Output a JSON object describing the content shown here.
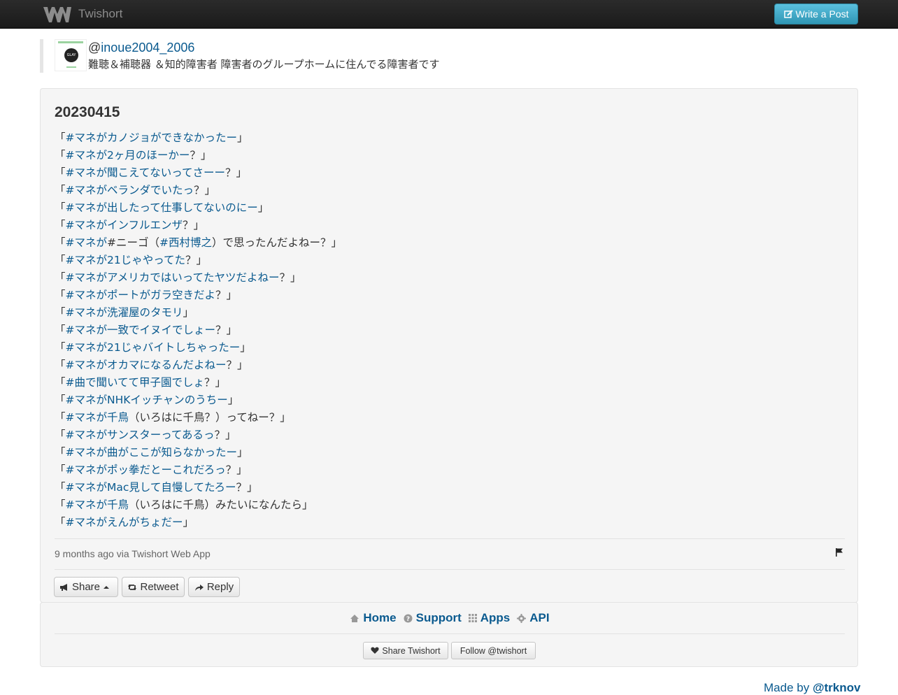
{
  "navbar": {
    "brand": "Twishort",
    "write_label": "Write a Post"
  },
  "profile": {
    "at": "@",
    "handle": "inoue2004_2006",
    "bio": "難聴＆補聴器 ＆知的障害者 障害者のグループホームに住んでる障害者です",
    "avatar_text": "GLAY"
  },
  "post": {
    "title": "20230415",
    "lines": [
      [
        "「",
        {
          "l": "#マネがカノジョができなかったー"
        },
        "」"
      ],
      [
        "「",
        {
          "l": "#マネが2ヶ月のほーかー"
        },
        "？」"
      ],
      [
        "「",
        {
          "l": "#マネが聞こえてないってさーー"
        },
        "？」"
      ],
      [
        "「",
        {
          "l": "#マネがベランダでいたっ"
        },
        "？」"
      ],
      [
        "「",
        {
          "l": "#マネが出したって仕事してないのにー"
        },
        "」"
      ],
      [
        "「",
        {
          "l": "#マネがインフルエンザ"
        },
        "？」"
      ],
      [
        "「",
        {
          "l": "#マネが"
        },
        "#ニーゴ（",
        {
          "l": "#西村博之"
        },
        "）で思ったんだよねー？」"
      ],
      [
        "「",
        {
          "l": "#マネが21じゃやってた"
        },
        "？」"
      ],
      [
        "「",
        {
          "l": "#マネがアメリカではいってたヤツだよねー"
        },
        "？」"
      ],
      [
        "「",
        {
          "l": "#マネがポートがガラ空きだよ"
        },
        "？」"
      ],
      [
        "「",
        {
          "l": "#マネが洗濯屋のタモリ"
        },
        "」"
      ],
      [
        "「",
        {
          "l": "#マネが一致でイヌイでしょー"
        },
        "？」"
      ],
      [
        "「",
        {
          "l": "#マネが21じゃバイトしちゃったー"
        },
        "」"
      ],
      [
        "「",
        {
          "l": "#マネがオカマになるんだよねー"
        },
        "？」"
      ],
      [
        "「",
        {
          "l": "#曲で聞いてて甲子園でしょ"
        },
        "？」"
      ],
      [
        "「",
        {
          "l": "#マネがNHKイッチャンのうちー"
        },
        "」"
      ],
      [
        "「",
        {
          "l": "#マネが千鳥"
        },
        "（いろはに千鳥？）ってねー？」"
      ],
      [
        "「",
        {
          "l": "#マネがサンスターってあるっ"
        },
        "？」"
      ],
      [
        "「",
        {
          "l": "#マネが曲がここが知らなかったー"
        },
        "」"
      ],
      [
        "「",
        {
          "l": "#マネがポッ拳だとーこれだろっ"
        },
        "？」"
      ],
      [
        "「",
        {
          "l": "#マネがMac見して自慢してたろー"
        },
        "？」"
      ],
      [
        "「",
        {
          "l": "#マネが千鳥"
        },
        "（いろはに千鳥）みたいになんたら」"
      ],
      [
        "「",
        {
          "l": "#マネがえんがちょだー"
        },
        "」"
      ]
    ],
    "meta": "9 months ago via Twishort Web App",
    "buttons": {
      "share": "Share",
      "retweet": "Retweet",
      "reply": "Reply"
    }
  },
  "footer": {
    "nav": {
      "home": "Home",
      "support": "Support",
      "apps": "Apps",
      "api": "API"
    },
    "share_twishort": "Share Twishort",
    "follow": "Follow @twishort"
  },
  "madeby": {
    "prefix": "Made by ",
    "author": "@trknov"
  },
  "colors": {
    "link": "#0a5a8f",
    "primary_button": "#49afcd",
    "navbar": "#222222"
  }
}
